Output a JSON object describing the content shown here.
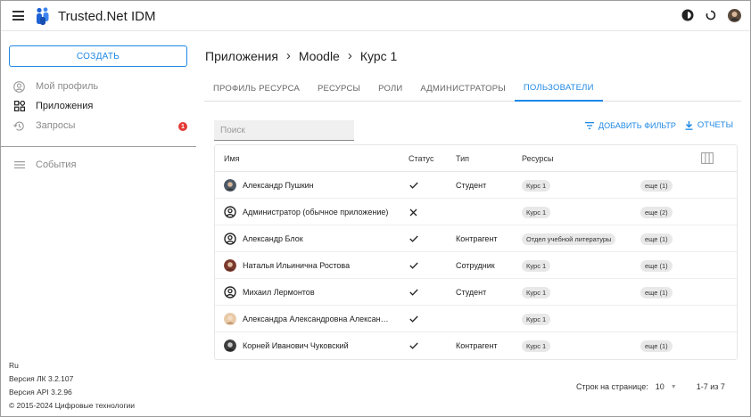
{
  "header": {
    "title": "Trusted.Net IDM",
    "icons": [
      "menu-icon",
      "theme-icon",
      "refresh-icon",
      "avatar"
    ]
  },
  "sidebar": {
    "create_label": "Создать",
    "items": [
      {
        "label": "Мой профиль",
        "icon": "account-circle-icon"
      },
      {
        "label": "Приложения",
        "icon": "apps-icon"
      },
      {
        "label": "Запросы",
        "icon": "history-icon",
        "badge": "1"
      },
      {
        "label": "События",
        "icon": "list-icon"
      }
    ],
    "footer": {
      "lang": "Ru",
      "lk_version": "Версия ЛК 3.2.107",
      "api_version": "Версия API 3.2.96",
      "copyright": "© 2015-2024 Цифровые технологии"
    }
  },
  "breadcrumb": [
    "Приложения",
    "Moodle",
    "Курс 1"
  ],
  "tabs": [
    "Профиль ресурса",
    "Ресурсы",
    "Роли",
    "Администраторы",
    "Пользователи"
  ],
  "active_tab": "Пользователи",
  "search": {
    "placeholder": "Поиск",
    "value": ""
  },
  "actions": {
    "add_filter": "Добавить фильтр",
    "reports": "Отчеты"
  },
  "table": {
    "columns": [
      "Имя",
      "Статус",
      "Тип",
      "Ресурсы"
    ],
    "rows": [
      {
        "name": "Александр Пушкин",
        "avatar": "photo",
        "status": "check",
        "type": "Студент",
        "resource": "Курс 1",
        "more": "еще (1)"
      },
      {
        "name": "Администратор (обычное приложение)",
        "avatar": "icon",
        "status": "cross",
        "type": "",
        "resource": "Курс 1",
        "more": "еще (2)"
      },
      {
        "name": "Александр Блок",
        "avatar": "icon",
        "status": "check",
        "type": "Контрагент",
        "resource": "Отдел учебной литературы",
        "more": "еще (1)"
      },
      {
        "name": "Наталья Ильинична Ростова",
        "avatar": "photo",
        "status": "check",
        "type": "Сотрудник",
        "resource": "Курс 1",
        "more": "еще (1)"
      },
      {
        "name": "Михаил Лермонтов",
        "avatar": "icon",
        "status": "check",
        "type": "Студент",
        "resource": "Курс 1",
        "more": "еще (1)"
      },
      {
        "name": "Александра Александровна Александрова",
        "avatar": "photo",
        "status": "check",
        "type": "",
        "resource": "Курс 1",
        "more": ""
      },
      {
        "name": "Корней Иванович Чуковский",
        "avatar": "photo",
        "status": "check",
        "type": "Контрагент",
        "resource": "Курс 1",
        "more": "еще (1)"
      }
    ]
  },
  "pagination": {
    "rows_per_page_label": "Строк на странице:",
    "rows_per_page": "10",
    "range": "1-7 из 7"
  },
  "colors": {
    "accent": "#1e88e5",
    "badge": "#e53935"
  }
}
